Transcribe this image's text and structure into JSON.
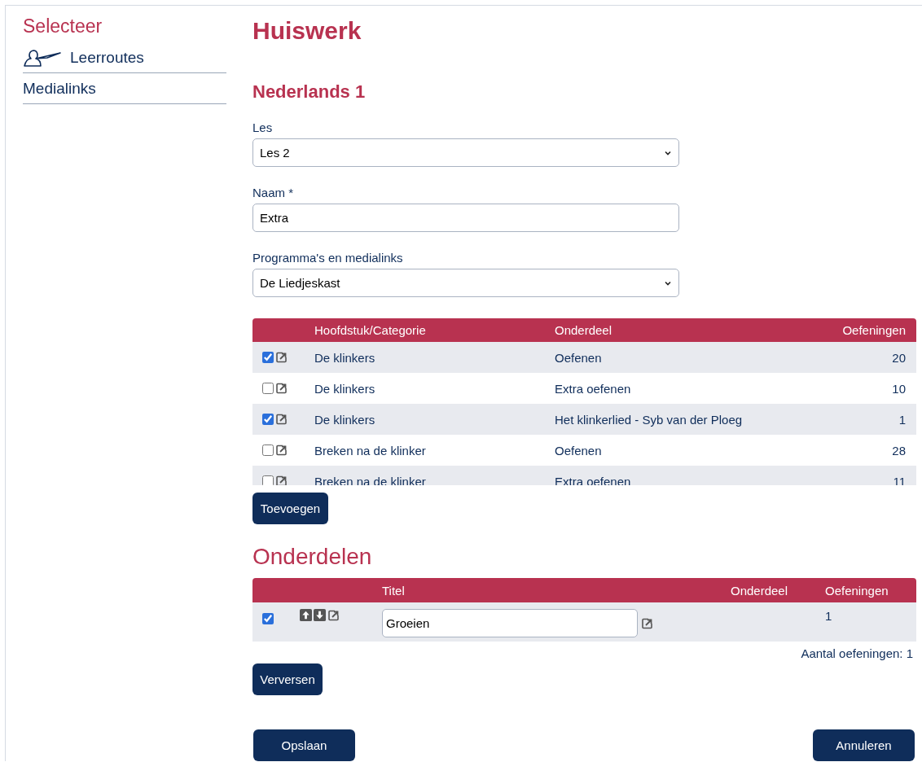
{
  "sidebar": {
    "title": "Selecteer",
    "items": [
      {
        "kind": "icon-link",
        "label": "Leerroutes"
      },
      {
        "kind": "link",
        "label": "Medialinks"
      }
    ]
  },
  "page_title": "Huiswerk",
  "course_title": "Nederlands 1",
  "fields": [
    {
      "kind": "select",
      "label": "Les",
      "value": "Les 2"
    },
    {
      "kind": "text",
      "label": "Naam *",
      "value": "Extra"
    },
    {
      "kind": "select",
      "label": "Programma's en medialinks",
      "value": "De Liedjeskast"
    }
  ],
  "exercises_table": {
    "columns": [
      "Hoofdstuk/Categorie",
      "Onderdeel",
      "Oefeningen"
    ],
    "rows": [
      {
        "checked": true,
        "chapter": "De klinkers",
        "part": "Oefenen",
        "count": "20"
      },
      {
        "checked": false,
        "chapter": "De klinkers",
        "part": "Extra oefenen",
        "count": "10"
      },
      {
        "checked": true,
        "chapter": "De klinkers",
        "part": "Het klinkerlied - Syb van der Ploeg",
        "count": "1"
      },
      {
        "checked": false,
        "chapter": "Breken na de klinker",
        "part": "Oefenen",
        "count": "28"
      },
      {
        "checked": false,
        "chapter": "Breken na de klinker",
        "part": "Extra oefenen",
        "count": "11"
      }
    ]
  },
  "add_button": "Toevoegen",
  "parts": {
    "title": "Onderdelen",
    "columns": [
      "Titel",
      "Onderdeel",
      "Oefeningen"
    ],
    "rows": [
      {
        "checked": true,
        "title": "Groeien",
        "count": "1"
      }
    ],
    "total": "Aantal oefeningen: 1"
  },
  "refresh_button": "Verversen",
  "save_button": "Opslaan",
  "cancel_button": "Annuleren"
}
